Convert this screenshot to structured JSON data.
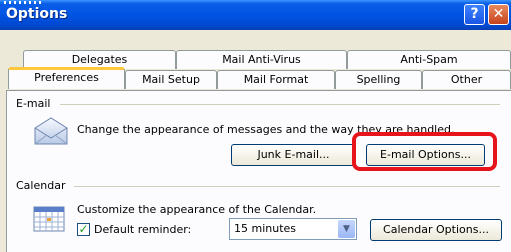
{
  "window": {
    "title": "Options",
    "help_glyph": "?",
    "close_glyph": "✕"
  },
  "tabs_row1": [
    "Delegates",
    "Mail Anti-Virus",
    "Anti-Spam"
  ],
  "tabs_row2": [
    "Preferences",
    "Mail Setup",
    "Mail Format",
    "Spelling",
    "Other"
  ],
  "email": {
    "section_label": "E-mail",
    "description": "Change the appearance of messages and the way they are handled.",
    "junk_button": "Junk E-mail...",
    "options_button": "E-mail Options..."
  },
  "calendar": {
    "section_label": "Calendar",
    "description": "Customize the appearance of the Calendar.",
    "reminder_label": "Default reminder:",
    "reminder_checked": true,
    "reminder_value": "15 minutes",
    "options_button": "Calendar Options..."
  },
  "colors": {
    "highlight": "#e8141b",
    "title_bar": "#0054e3"
  }
}
